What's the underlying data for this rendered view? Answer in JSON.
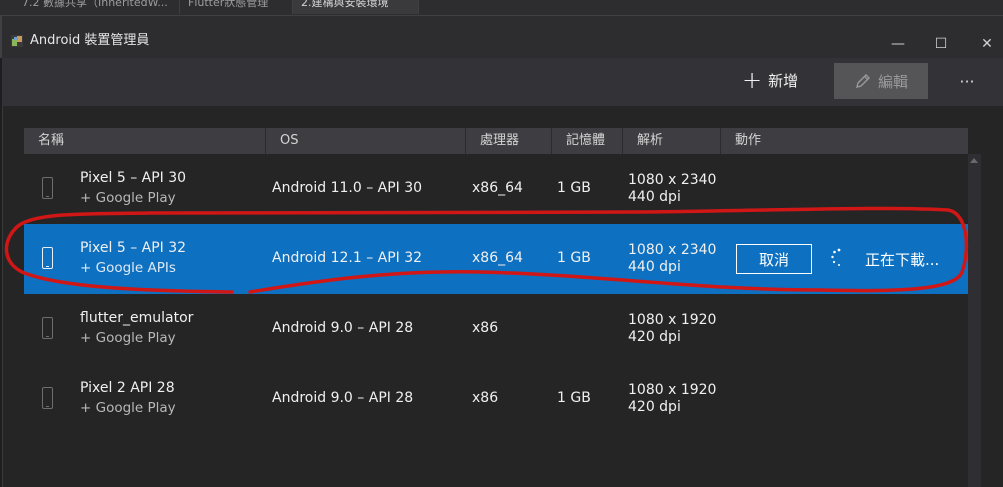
{
  "editor_tabs": [
    {
      "label": "7.2 數據共享（InheritedW..."
    },
    {
      "label": "Flutter狀態管理"
    },
    {
      "label": "2.建構與安裝環境"
    }
  ],
  "window": {
    "title": "Android 裝置管理員",
    "minimize_glyph": "—",
    "maximize_glyph": "☐",
    "close_glyph": "✕"
  },
  "toolbar": {
    "add_icon": "+",
    "add_label": "新增",
    "edit_label": "編輯",
    "more_label": "···"
  },
  "table": {
    "columns": [
      "名稱",
      "OS",
      "處理器",
      "記憶體",
      "解析",
      "動作"
    ],
    "rows": [
      {
        "name": "Pixel 5 – API 30",
        "subtitle": "+ Google Play",
        "os": "Android 11.0 – API 30",
        "cpu": "x86_64",
        "memory": "1 GB",
        "resolution": "1080 x 2340",
        "dpi": "440 dpi",
        "selected": false
      },
      {
        "name": "Pixel 5 – API 32",
        "subtitle": "+ Google APIs",
        "os": "Android 12.1 – API 32",
        "cpu": "x86_64",
        "memory": "1 GB",
        "resolution": "1080 x 2340",
        "dpi": "440 dpi",
        "selected": true,
        "action_button": "取消",
        "status": "正在下載..."
      },
      {
        "name": "flutter_emulator",
        "subtitle": "+ Google Play",
        "os": "Android 9.0 – API 28",
        "cpu": "x86",
        "memory": "",
        "resolution": "1080 x 1920",
        "dpi": "420 dpi",
        "selected": false
      },
      {
        "name": "Pixel 2 API 28",
        "subtitle": "+ Google Play",
        "os": "Android 9.0 – API 28",
        "cpu": "x86",
        "memory": "1 GB",
        "resolution": "1080 x 1920",
        "dpi": "420 dpi",
        "selected": false
      }
    ]
  },
  "colors": {
    "accent": "#0e70c0",
    "annotation": "#d11616"
  },
  "icons": {
    "app": "android-app-icon",
    "add": "plus-icon",
    "edit": "pencil-icon",
    "device": "phone-icon",
    "spinner": "loading-spinner-icon"
  }
}
